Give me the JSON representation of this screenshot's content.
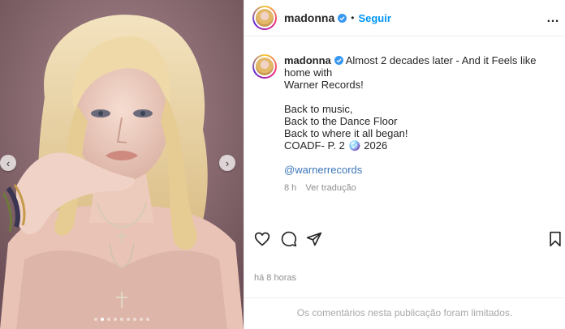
{
  "account": {
    "username": "madonna",
    "separator": "•",
    "follow_label": "Seguir",
    "more_icon": "…"
  },
  "caption": {
    "username": "madonna",
    "lines": [
      "Almost 2 decades later - And it Feels like home with",
      "Warner Records!",
      "Back to music,",
      "Back to the Dance Floor",
      "Back to where it all began!",
      "COADF- P. 2 🪩 2026",
      "@warnerrecords"
    ],
    "age": "8 h",
    "translate_label": "Ver tradução"
  },
  "footer": {
    "timestamp": "há 8 horas",
    "comments_limited": "Os comentários nesta publicação foram limitados."
  },
  "carousel": {
    "prev_icon": "‹",
    "next_icon": "›",
    "slide_count": 9,
    "active_slide": 1
  },
  "colors": {
    "accent": "#0095f6",
    "mention": "#3b76b8",
    "muted": "#8e8e8e",
    "verified": "#3897f0"
  },
  "icons": [
    "heart-icon",
    "comment-icon",
    "share-icon",
    "bookmark-icon",
    "verified-icon",
    "more-icon"
  ]
}
